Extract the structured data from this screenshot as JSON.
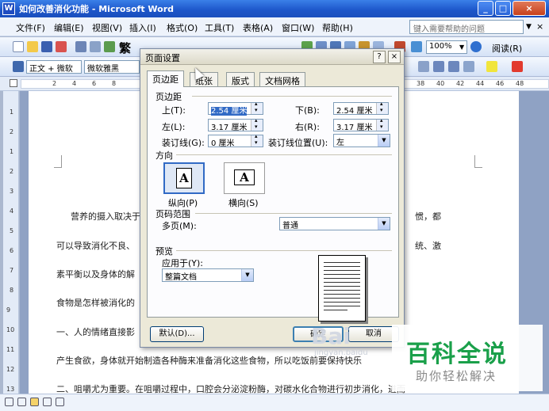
{
  "window": {
    "title": "如何改善消化功能 - Microsoft Word",
    "min": "_",
    "max": "□",
    "close": "×"
  },
  "menu": {
    "items": [
      "文件(F)",
      "编辑(E)",
      "视图(V)",
      "插入(I)",
      "格式(O)",
      "工具(T)",
      "表格(A)",
      "窗口(W)",
      "帮助(H)"
    ],
    "help_placeholder": "键入需要帮助的问题"
  },
  "toolbar": {
    "zoom": "100%",
    "read_label": "阅读(R)",
    "trad_label": "繁"
  },
  "format_bar": {
    "style": "正文 + 微软",
    "font": "微软雅黑"
  },
  "ruler": {
    "top_numbers": [
      "2",
      "4",
      "6",
      "8",
      "38",
      "40",
      "42",
      "44",
      "46",
      "48"
    ],
    "side_numbers": [
      "1",
      "2",
      "1",
      "2",
      "3",
      "4",
      "5",
      "6",
      "7",
      "8",
      "9",
      "10",
      "11",
      "12",
      "13"
    ]
  },
  "document": {
    "lines": [
      "营养的摄入取决于",
      "惯，都",
      "可以导致消化不良、",
      "统、激",
      "素平衡以及身体的解",
      "食物是怎样被消化的",
      "一、人的情绪直接影",
      "产生食欲，身体就开始制造各种酶来准备消化这些食物，所以吃饭前要保持快乐",
      "二、咀嚼尤为重要。在咀嚼过程中，口腔会分泌淀粉酶，对碳水化合物进行初步消化，进而"
    ]
  },
  "dialog": {
    "title": "页面设置",
    "help": "?",
    "close": "×",
    "tabs": [
      "页边距",
      "纸张",
      "版式",
      "文档网格"
    ],
    "margins_group": "页边距",
    "top_label": "上(T):",
    "top_value": "2.54 厘米",
    "bottom_label": "下(B):",
    "bottom_value": "2.54 厘米",
    "left_label": "左(L):",
    "left_value": "3.17 厘米",
    "right_label": "右(R):",
    "right_value": "3.17 厘米",
    "gutter_label": "装订线(G):",
    "gutter_value": "0 厘米",
    "gutter_pos_label": "装订线位置(U):",
    "gutter_pos_value": "左",
    "orientation_group": "方向",
    "portrait_label": "纵向(P)",
    "landscape_label": "横向(S)",
    "orient_glyph": "A",
    "pages_group": "页码范围",
    "multiple_label": "多页(M):",
    "multiple_value": "普通",
    "preview_group": "预览",
    "apply_label": "应用于(Y):",
    "apply_value": "整篇文档",
    "default_btn": "默认(D)...",
    "ok_btn": "确定",
    "cancel_btn": "取消"
  },
  "watermark": {
    "brand": "百科全说",
    "tagline": "助你轻松解决",
    "baidu": "Bai",
    "jingyan": "jingyan.baidu"
  },
  "colors": {
    "accent": "#316ac5",
    "brand_green": "#1aa04a"
  }
}
